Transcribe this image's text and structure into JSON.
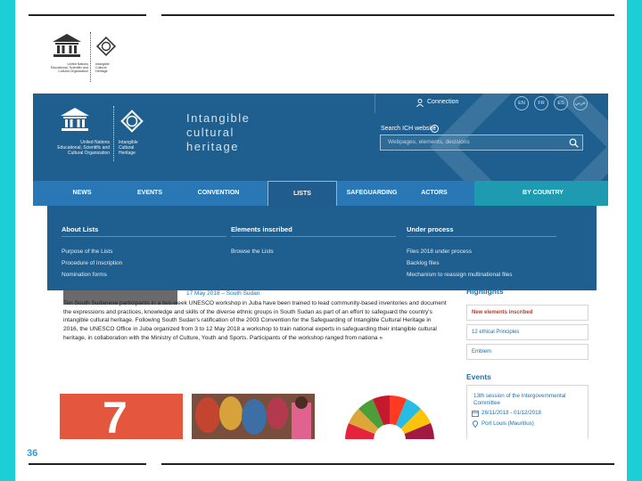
{
  "slide": {
    "number": "36"
  },
  "top_logo": {
    "un_text": [
      "United Nations",
      "Educational, Scientific and",
      "Cultural Organization"
    ],
    "ich_text": [
      "Intangible",
      "Cultural",
      "Heritage"
    ]
  },
  "header": {
    "un_text": [
      "United Nations",
      "Educational, Scientific and",
      "Cultural Organization"
    ],
    "ich_text": [
      "Intangible",
      "Cultural",
      "Heritage"
    ],
    "site_title": [
      "Intangible",
      "cultural",
      "heritage"
    ],
    "connect": "Connection",
    "languages": [
      "EN",
      "FR",
      "ES",
      "عربي"
    ],
    "search_label": "Search ICH website",
    "search_placeholder": "Webpages, elements, decisions"
  },
  "nav": {
    "items": [
      "NEWS",
      "EVENTS",
      "CONVENTION",
      "LISTS",
      "SAFEGUARDING",
      "ACTORS",
      "BY COUNTRY"
    ],
    "active": "LISTS"
  },
  "mega_menu": {
    "columns": [
      {
        "heading": "About Lists",
        "links": [
          "Purpose of the Lists",
          "Procedure of inscription",
          "Nomination forms"
        ]
      },
      {
        "heading": "Elements inscribed",
        "links": [
          "Browse the Lists"
        ]
      },
      {
        "heading": "Under process",
        "links": [
          "Files 2018 under process",
          "Backlog files",
          "Mechanism to reassign multinational files"
        ]
      }
    ]
  },
  "article": {
    "date_place": "17 May 2018 – South Sudan",
    "body": "Ten South Sudanese participants in a two-week UNESCO workshop in Juba have been trained to lead community-based inventories and document the expressions and practices, knowledge and skills of the diverse ethnic groups in South Sudan as part of an effort to safeguard the country's intangible cultural heritage. Following South Sudan's ratification of the 2003 Convention for the Safeguarding of Intangible Cultural Heritage in 2016, the UNESCO Office in Juba organized from 3 to 12 May 2018 a workshop to train national experts in safeguarding their intangible cultural heritage, in collaboration with the Ministry of Culture, Youth and Sports. Participants of the workshop ranged from nationa »"
  },
  "sidebar": {
    "highlights_title": "Highlights",
    "highlights": [
      "New elements inscribed",
      "12 ethical Principles",
      "Emblem"
    ],
    "events_title": "Events",
    "event": {
      "title": "13th session of the Intergovernmental Committee",
      "dates": "26/11/2018 - 01/12/2018",
      "place": "Port Louis (Mauritius)"
    }
  },
  "tiles": {
    "seven": "7"
  },
  "colors": {
    "header": "#1e5f8f",
    "nav": "#2a77b5",
    "accent": "#1e9bb0",
    "frame": "#1ccfd6"
  }
}
